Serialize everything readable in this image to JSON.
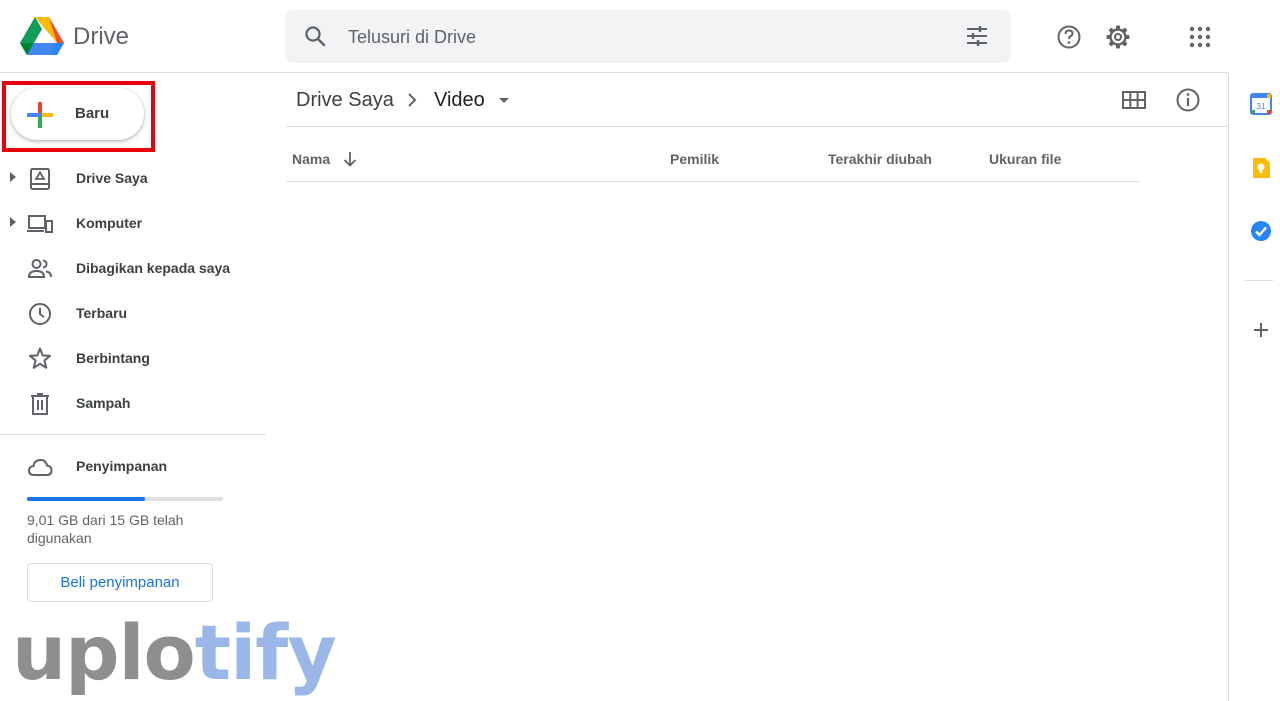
{
  "header": {
    "brand": "Drive",
    "search_placeholder": "Telusuri di Drive"
  },
  "sidebar": {
    "new_label": "Baru",
    "items": [
      {
        "label": "Drive Saya",
        "icon": "my-drive-icon",
        "expandable": true
      },
      {
        "label": "Komputer",
        "icon": "computer-icon",
        "expandable": true
      },
      {
        "label": "Dibagikan kepada saya",
        "icon": "shared-icon",
        "expandable": false
      },
      {
        "label": "Terbaru",
        "icon": "recent-clock-icon",
        "expandable": false
      },
      {
        "label": "Berbintang",
        "icon": "star-icon",
        "expandable": false
      },
      {
        "label": "Sampah",
        "icon": "trash-icon",
        "expandable": false
      }
    ],
    "storage": {
      "label": "Penyimpanan",
      "usage_text": "9,01 GB dari 15 GB telah digunakan",
      "used_fraction": 0.6,
      "buy_label": "Beli penyimpanan"
    }
  },
  "main": {
    "breadcrumb_root": "Drive Saya",
    "breadcrumb_current": "Video",
    "columns": [
      "Nama",
      "Pemilik",
      "Terakhir diubah",
      "Ukuran file"
    ]
  },
  "watermark": {
    "part1": "uplo",
    "part2": "tify"
  },
  "colors": {
    "accent": "#1a73e8",
    "highlight": "#e8000b"
  }
}
